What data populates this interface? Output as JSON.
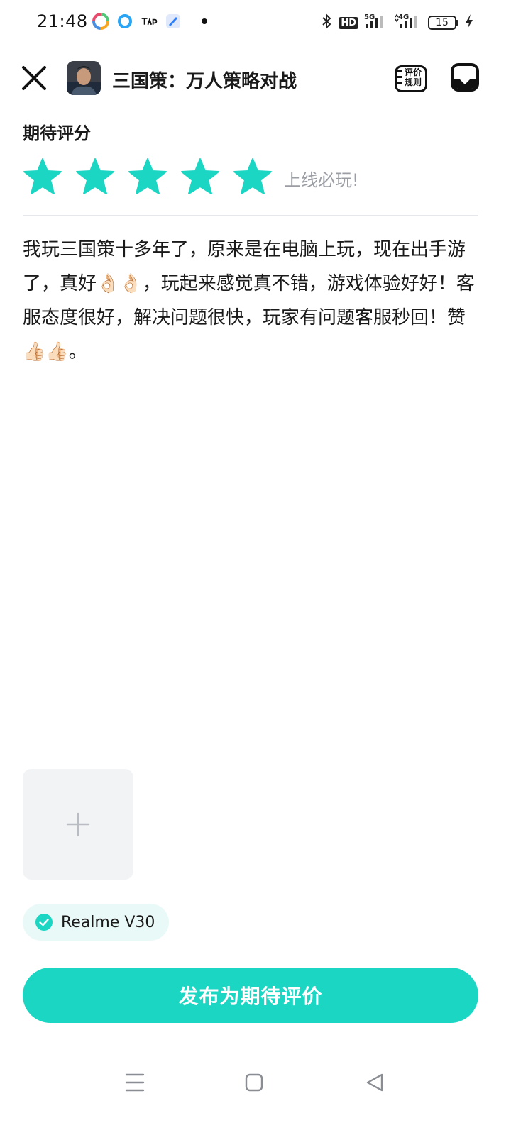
{
  "status_bar": {
    "time": "21:48",
    "hd_badge": "HD",
    "network_5g": "5G",
    "network_4g": "4G",
    "battery": "15"
  },
  "header": {
    "game_title": "三国策：万人策略对战",
    "rules_label_line1": "评价",
    "rules_label_line2": "规则"
  },
  "rating": {
    "section_label": "期待评分",
    "stars_filled": 5,
    "stars_total": 5,
    "caption": "上线必玩!",
    "accent_color": "#1cd6c4"
  },
  "review": {
    "text": "我玩三国策十多年了，原来是在电脑上玩，现在出手游了，真好👌🏻👌🏻，玩起来感觉真不错，游戏体验好好！客服态度很好，解决问题很快，玩家有问题客服秒回！赞👍🏻👍🏻。"
  },
  "upload": {
    "icon": "plus-icon"
  },
  "device": {
    "label": "Realme V30",
    "icon": "check-circle-icon"
  },
  "submit": {
    "label": "发布为期待评价",
    "color": "#1cd6c4"
  },
  "nav": {
    "icons": [
      "menu-icon",
      "home-icon",
      "back-icon"
    ]
  }
}
